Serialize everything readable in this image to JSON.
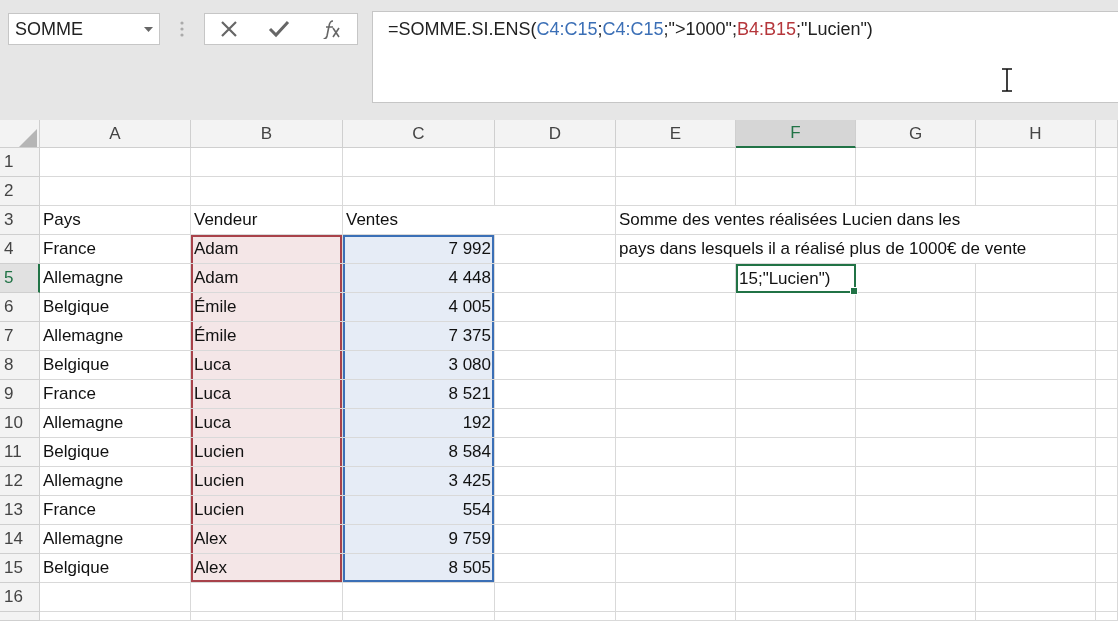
{
  "name_box": {
    "value": "SOMME"
  },
  "formula_bar": {
    "segments": [
      {
        "text": "=SOMME.SI.ENS("
      },
      {
        "text": "C4:C15",
        "color": "#3b6fb6"
      },
      {
        "text": ";"
      },
      {
        "text": "C4:C15",
        "color": "#3b6fb6"
      },
      {
        "text": ";\">1000\";"
      },
      {
        "text": "B4:B15",
        "color": "#b5363b"
      },
      {
        "text": ";\"Lucien\")"
      }
    ]
  },
  "columns": [
    {
      "label": "A",
      "selected": false
    },
    {
      "label": "B",
      "selected": false
    },
    {
      "label": "C",
      "selected": false
    },
    {
      "label": "D",
      "selected": false
    },
    {
      "label": "E",
      "selected": false
    },
    {
      "label": "F",
      "selected": true
    },
    {
      "label": "G",
      "selected": false
    },
    {
      "label": "H",
      "selected": false
    }
  ],
  "rows": [
    {
      "label": "1",
      "selected": false,
      "cells": []
    },
    {
      "label": "2",
      "selected": false,
      "cells": []
    },
    {
      "label": "3",
      "selected": false,
      "cells": [
        {
          "kind": "text",
          "text": "Pays"
        },
        {
          "kind": "text",
          "text": "Vendeur"
        },
        {
          "kind": "text",
          "text": "Ventes"
        },
        {},
        {
          "kind": "text",
          "text": "Somme des ventes réalisées Lucien dans les"
        }
      ]
    },
    {
      "label": "4",
      "selected": false,
      "cells": [
        {
          "kind": "text",
          "text": "France"
        },
        {
          "kind": "text",
          "text": "Adam",
          "color": "#a8424a"
        },
        {
          "kind": "number",
          "text": "7 992",
          "color": "#3b6fb6"
        },
        {},
        {
          "kind": "text",
          "text": "pays dans lesquels il a réalisé plus de 1000€ de vente"
        }
      ]
    },
    {
      "label": "5",
      "selected": true,
      "cells": [
        {
          "kind": "text",
          "text": "Allemagne"
        },
        {
          "kind": "text",
          "text": "Adam",
          "color": "#a8424a"
        },
        {
          "kind": "number",
          "text": "4 448",
          "color": "#3b6fb6"
        },
        {},
        {},
        {
          "kind": "editing",
          "text": "15;\"Lucien\")"
        }
      ]
    },
    {
      "label": "6",
      "selected": false,
      "cells": [
        {
          "kind": "text",
          "text": "Belgique"
        },
        {
          "kind": "text",
          "text": "Émile",
          "color": "#a8424a"
        },
        {
          "kind": "number",
          "text": "4 005",
          "color": "#3b6fb6"
        }
      ]
    },
    {
      "label": "7",
      "selected": false,
      "cells": [
        {
          "kind": "text",
          "text": "Allemagne"
        },
        {
          "kind": "text",
          "text": "Émile",
          "color": "#a8424a"
        },
        {
          "kind": "number",
          "text": "7 375",
          "color": "#3b6fb6"
        }
      ]
    },
    {
      "label": "8",
      "selected": false,
      "cells": [
        {
          "kind": "text",
          "text": "Belgique"
        },
        {
          "kind": "text",
          "text": "Luca",
          "color": "#a8424a"
        },
        {
          "kind": "number",
          "text": "3 080",
          "color": "#3b6fb6"
        }
      ]
    },
    {
      "label": "9",
      "selected": false,
      "cells": [
        {
          "kind": "text",
          "text": "France"
        },
        {
          "kind": "text",
          "text": "Luca",
          "color": "#a8424a"
        },
        {
          "kind": "number",
          "text": "8 521",
          "color": "#3b6fb6"
        }
      ]
    },
    {
      "label": "10",
      "selected": false,
      "cells": [
        {
          "kind": "text",
          "text": "Allemagne"
        },
        {
          "kind": "text",
          "text": "Luca",
          "color": "#a8424a"
        },
        {
          "kind": "number",
          "text": "192",
          "color": "#3b6fb6"
        }
      ]
    },
    {
      "label": "11",
      "selected": false,
      "cells": [
        {
          "kind": "text",
          "text": "Belgique"
        },
        {
          "kind": "text",
          "text": "Lucien",
          "color": "#a8424a"
        },
        {
          "kind": "number",
          "text": "8 584",
          "color": "#3b6fb6"
        }
      ]
    },
    {
      "label": "12",
      "selected": false,
      "cells": [
        {
          "kind": "text",
          "text": "Allemagne"
        },
        {
          "kind": "text",
          "text": "Lucien",
          "color": "#a8424a"
        },
        {
          "kind": "number",
          "text": "3 425",
          "color": "#3b6fb6"
        }
      ]
    },
    {
      "label": "13",
      "selected": false,
      "cells": [
        {
          "kind": "text",
          "text": "France"
        },
        {
          "kind": "text",
          "text": "Lucien",
          "color": "#a8424a"
        },
        {
          "kind": "number",
          "text": "554",
          "color": "#3b6fb6"
        }
      ]
    },
    {
      "label": "14",
      "selected": false,
      "cells": [
        {
          "kind": "text",
          "text": "Allemagne"
        },
        {
          "kind": "text",
          "text": "Alex",
          "color": "#a8424a"
        },
        {
          "kind": "number",
          "text": "9 759",
          "color": "#3b6fb6"
        }
      ]
    },
    {
      "label": "15",
      "selected": false,
      "cells": [
        {
          "kind": "text",
          "text": "Belgique"
        },
        {
          "kind": "text",
          "text": "Alex",
          "color": "#a8424a"
        },
        {
          "kind": "number",
          "text": "8 505",
          "color": "#3b6fb6"
        }
      ]
    },
    {
      "label": "16",
      "selected": false,
      "cells": []
    }
  ]
}
